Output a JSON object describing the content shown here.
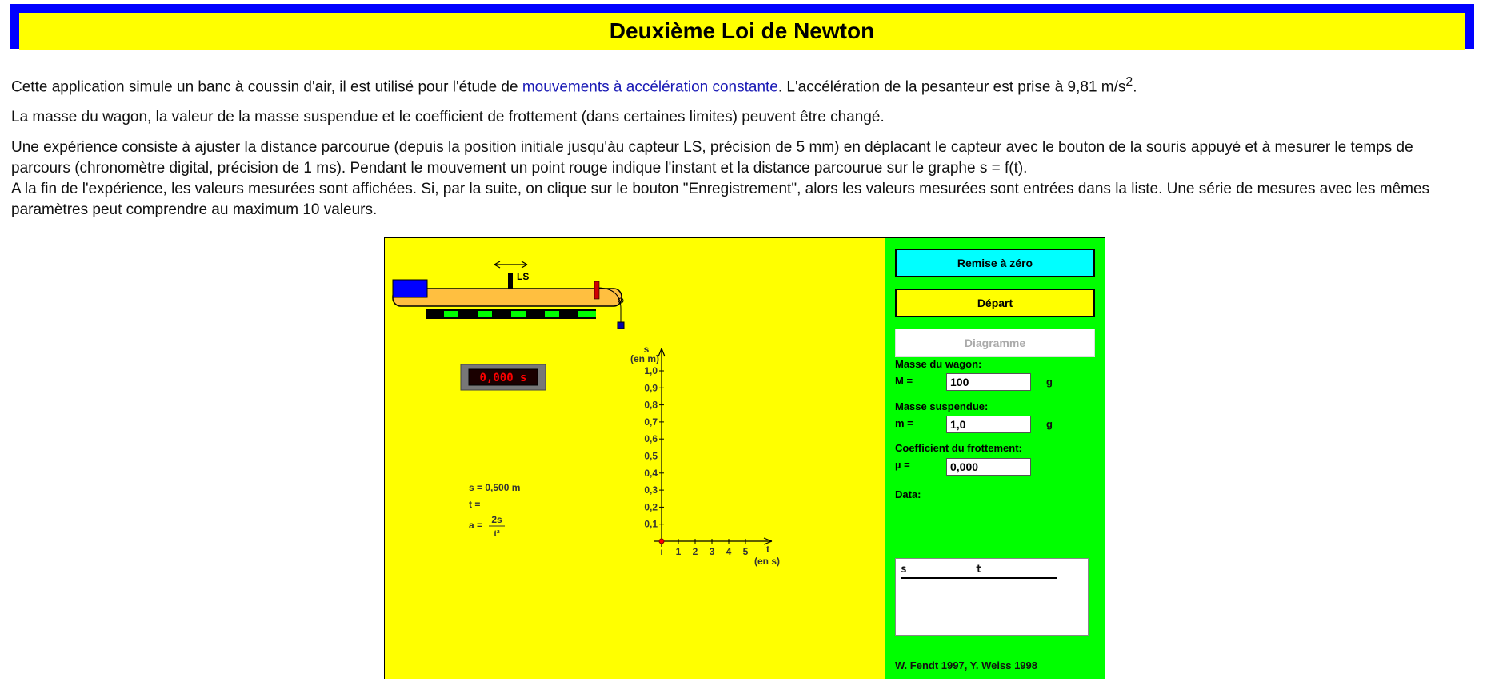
{
  "page": {
    "title": "Deuxième Loi de Newton",
    "intro1_pre": "Cette application simule un banc à coussin d'air, il est utilisé pour l'étude de ",
    "intro1_link": "mouvements à accélération constante",
    "intro1_post": ". L'accélération de la pesanteur est prise à 9,81 m/s",
    "intro1_sup": "2",
    "intro1_end": ".",
    "intro2": "La masse du wagon, la valeur de la masse suspendue et le coefficient de frottement (dans certaines limites) peuvent être changé.",
    "intro3": "Une expérience consiste à ajuster la distance parcourue (depuis la position initiale jusqu'àu capteur LS, précision de 5 mm) en déplacant le capteur avec le bouton de la souris appuyé et à mesurer le temps de parcours (chronomètre digital, précision de 1 ms). Pendant le mouvement un point rouge indique l'instant et la distance parcourue sur le graphe s = f(t).",
    "intro4": "A la fin de l'expérience, les valeurs mesurées sont affichées. Si, par la suite, on clique sur le bouton \"Enregistrement\", alors les valeurs mesurées sont entrées dans la liste. Une série de mesures avec les mêmes paramètres peut comprendre au maximum 10 valeurs."
  },
  "simulation": {
    "sensor_label": "LS",
    "timer_display": "0,000 s",
    "readout_s": "s = 0,500 m",
    "readout_t": "t =",
    "readout_a": "a =",
    "formula_num": "2s",
    "formula_den": "t²",
    "graph": {
      "y_label_1": "s",
      "y_label_2": "(en m)",
      "x_label_1": "t",
      "x_label_2": "(en s)",
      "y_ticks": [
        "0,1",
        "0,2",
        "0,3",
        "0,4",
        "0,5",
        "0,6",
        "0,7",
        "0,8",
        "0,9",
        "1,0"
      ],
      "x_ticks": [
        "1",
        "2",
        "3",
        "4",
        "5"
      ],
      "origin_label": "0"
    }
  },
  "controls": {
    "reset_label": "Remise à zéro",
    "start_label": "Départ",
    "diagram_label": "Diagramme",
    "wagon_mass_heading": "Masse du wagon:",
    "wagon_mass_symbol": "M =",
    "wagon_mass_value": "100",
    "wagon_mass_unit": "g",
    "hung_mass_heading": "Masse suspendue:",
    "hung_mass_symbol": "m =",
    "hung_mass_value": "1,0",
    "hung_mass_unit": "g",
    "friction_heading": "Coefficient du frottement:",
    "friction_symbol": "µ =",
    "friction_value": "0,000",
    "data_heading": "Data:",
    "data_col_s": "s",
    "data_col_t": "t",
    "credit": "W. Fendt 1997,  Y. Weiss 1998"
  },
  "colors": {
    "title_border": "#0000ff",
    "title_bg": "#ffff00",
    "stage_bg": "#ffff00",
    "panel_bg": "#00ff00",
    "reset_bg": "#00ffff",
    "track": "#ffbf40",
    "wagon": "#0000ff",
    "sensor_stripes": "#00ff00",
    "timer_digits": "#ff0000",
    "graph_point": "#ff0000"
  }
}
